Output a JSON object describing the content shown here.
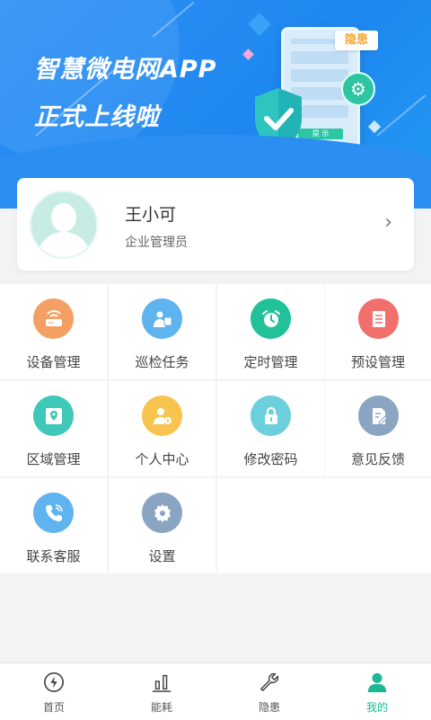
{
  "banner": {
    "title_line1": "智慧微电网APP",
    "title_line2": "正式上线啦",
    "tag_text": "隐患",
    "phone_button_text": "提 示"
  },
  "profile": {
    "name": "王小可",
    "role": "企业管理员",
    "arrow": "›"
  },
  "menu": [
    {
      "label": "设备管理",
      "icon": "router-icon",
      "color": "#f4a064"
    },
    {
      "label": "巡检任务",
      "icon": "inspector-icon",
      "color": "#5fb3ee"
    },
    {
      "label": "定时管理",
      "icon": "alarm-clock-icon",
      "color": "#21c19a"
    },
    {
      "label": "预设管理",
      "icon": "document-list-icon",
      "color": "#f16f6d"
    },
    {
      "label": "区域管理",
      "icon": "location-pin-icon",
      "color": "#3ec8b7"
    },
    {
      "label": "个人中心",
      "icon": "user-settings-icon",
      "color": "#f7c44f"
    },
    {
      "label": "修改密码",
      "icon": "lock-icon",
      "color": "#6bd0dc"
    },
    {
      "label": "意见反馈",
      "icon": "edit-document-icon",
      "color": "#8aa5c1"
    },
    {
      "label": "联系客服",
      "icon": "phone-call-icon",
      "color": "#5fb3ee"
    },
    {
      "label": "设置",
      "icon": "gear-icon",
      "color": "#8aa5c1"
    }
  ],
  "tabs": [
    {
      "label": "首页",
      "icon": "lightning-icon",
      "active": false
    },
    {
      "label": "能耗",
      "icon": "bar-chart-icon",
      "active": false
    },
    {
      "label": "隐患",
      "icon": "wrench-icon",
      "active": false
    },
    {
      "label": "我的",
      "icon": "person-icon",
      "active": true
    }
  ],
  "colors": {
    "banner_blue": "#1e88f0",
    "accent_green": "#1db794"
  }
}
